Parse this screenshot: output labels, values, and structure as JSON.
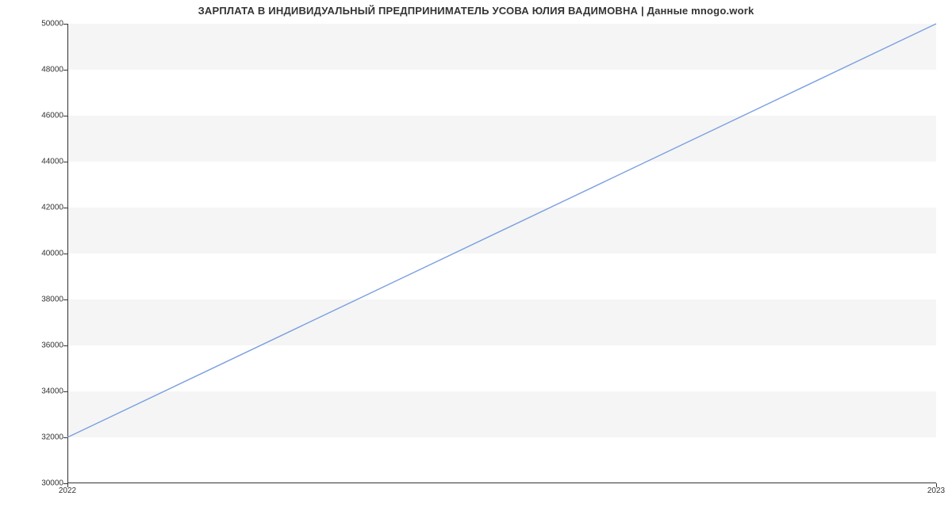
{
  "chart_data": {
    "type": "line",
    "title": "ЗАРПЛАТА В ИНДИВИДУАЛЬНЫЙ ПРЕДПРИНИМАТЕЛЬ УСОВА ЮЛИЯ ВАДИМОВНА | Данные mnogo.work",
    "x": [
      "2022",
      "2023"
    ],
    "values": [
      32000,
      50000
    ],
    "xlabel": "",
    "ylabel": "",
    "ylim": [
      30000,
      50000
    ],
    "y_ticks": [
      30000,
      32000,
      34000,
      36000,
      38000,
      40000,
      42000,
      44000,
      46000,
      48000,
      50000
    ],
    "x_ticks": [
      "2022",
      "2023"
    ],
    "grid": true,
    "line_color": "#7a9fe0"
  }
}
